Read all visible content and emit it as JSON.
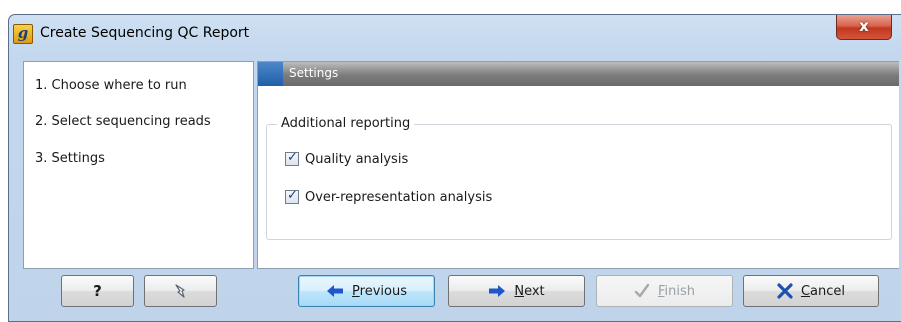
{
  "window": {
    "title": "Create Sequencing QC Report",
    "app_icon_glyph": "g",
    "close_label": "x"
  },
  "steps": [
    {
      "label": "1.  Choose where to run"
    },
    {
      "label": "2.  Select sequencing reads"
    },
    {
      "label": "3.  Settings"
    }
  ],
  "settings": {
    "header": "Settings",
    "group_label": "Additional reporting",
    "options": [
      {
        "label": "Quality analysis",
        "checked": true
      },
      {
        "label": "Over-representation analysis",
        "checked": true
      }
    ]
  },
  "buttons": {
    "help": "?",
    "previous": {
      "mnemonic": "P",
      "rest": "revious"
    },
    "next": {
      "mnemonic": "N",
      "rest": "ext"
    },
    "finish": {
      "mnemonic": "F",
      "rest": "inish"
    },
    "cancel": {
      "mnemonic": "C",
      "rest": "ancel"
    }
  },
  "icons": {
    "app": "sequence-g-icon",
    "help": "question-mark",
    "reset": "reset-arrow-icon",
    "previous": "left-arrow-icon",
    "next": "right-arrow-icon",
    "finish": "checkmark-icon",
    "cancel": "x-mark-icon"
  },
  "colors": {
    "titlebar": "#c3d7ee",
    "close_button": "#c0391f",
    "settings_header": "#7c7c7c",
    "settings_marker": "#1f5fa7",
    "primary_button_border": "#3c7fb1"
  }
}
